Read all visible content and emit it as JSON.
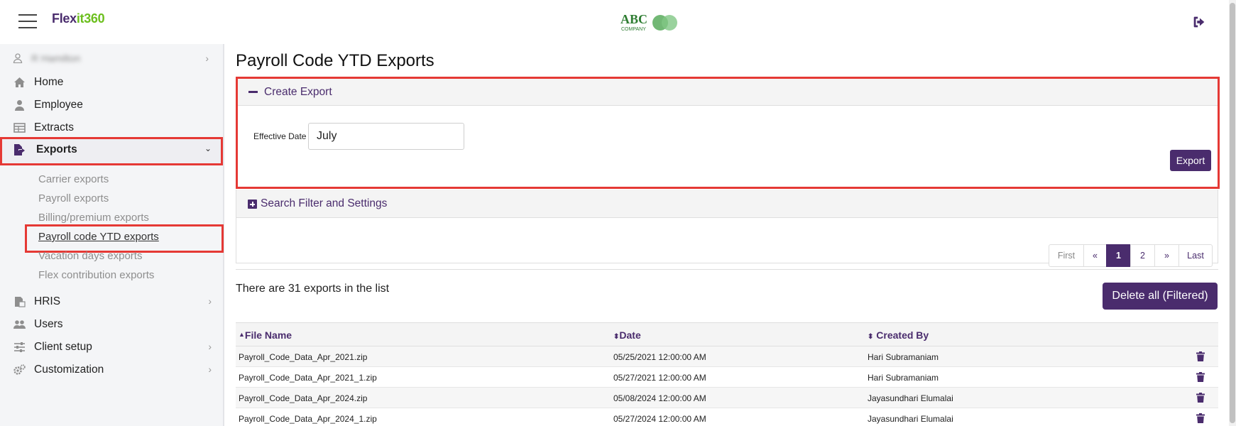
{
  "header": {
    "brand_part1": "Flex",
    "brand_part2": "it360",
    "company_logo_text": "ABC",
    "company_logo_subtext": "COMPANY"
  },
  "sidebar": {
    "user_name": "R Hamilton",
    "items": [
      {
        "label": "Home",
        "icon": "home-icon"
      },
      {
        "label": "Employee",
        "icon": "employee-icon"
      },
      {
        "label": "Extracts",
        "icon": "table-icon"
      },
      {
        "label": "Exports",
        "icon": "file-export-icon"
      },
      {
        "label": "HRIS",
        "icon": "hris-icon"
      },
      {
        "label": "Users",
        "icon": "users-icon"
      },
      {
        "label": "Client setup",
        "icon": "sliders-icon"
      },
      {
        "label": "Customization",
        "icon": "gears-icon"
      }
    ],
    "exports_submenu": [
      "Carrier exports",
      "Payroll exports",
      "Billing/premium exports",
      "Payroll code YTD exports",
      "Vacation days exports",
      "Flex contribution exports"
    ]
  },
  "main": {
    "title": "Payroll Code YTD Exports",
    "create_export": {
      "title": "Create Export",
      "effective_date_label": "Effective Date",
      "effective_date_value": "July",
      "export_button": "Export"
    },
    "search_filter": {
      "title": "Search Filter and Settings"
    },
    "pager": {
      "first": "First",
      "prev": "«",
      "pages": [
        "1",
        "2"
      ],
      "current_page": "1",
      "next": "»",
      "last": "Last"
    },
    "count_text": "There are 31 exports in the list",
    "delete_button": "Delete all (Filtered)",
    "table": {
      "columns": [
        "File Name",
        "Date",
        "Created By"
      ],
      "rows": [
        {
          "file": "Payroll_Code_Data_Apr_2021.zip",
          "date": "05/25/2021 12:00:00 AM",
          "by": "Hari Subramaniam"
        },
        {
          "file": "Payroll_Code_Data_Apr_2021_1.zip",
          "date": "05/27/2021 12:00:00 AM",
          "by": "Hari Subramaniam"
        },
        {
          "file": "Payroll_Code_Data_Apr_2024.zip",
          "date": "05/08/2024 12:00:00 AM",
          "by": "Jayasundhari Elumalai"
        },
        {
          "file": "Payroll_Code_Data_Apr_2024_1.zip",
          "date": "05/27/2024 12:00:00 AM",
          "by": "Jayasundhari Elumalai"
        }
      ]
    }
  },
  "colors": {
    "brand_purple": "#4a2c6d",
    "brand_green": "#6cbf1e",
    "highlight_red": "#e53935"
  }
}
